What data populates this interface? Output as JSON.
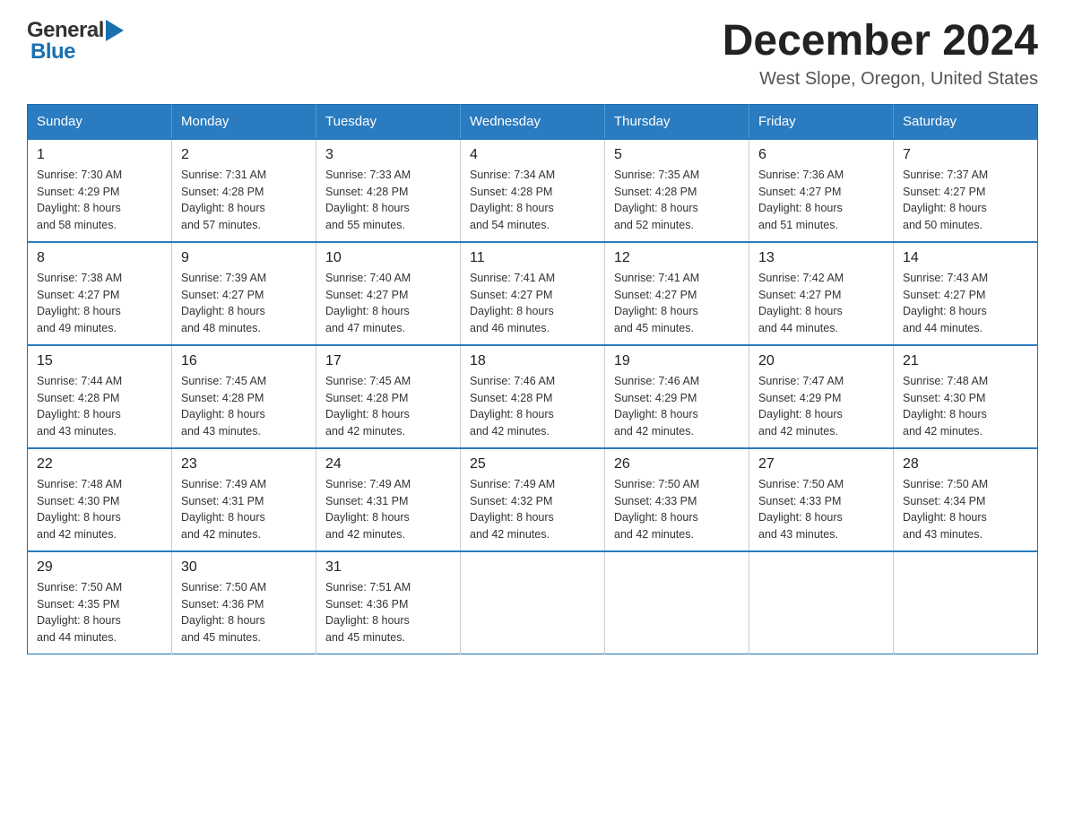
{
  "header": {
    "logo_general": "General",
    "logo_blue": "Blue",
    "month_title": "December 2024",
    "location": "West Slope, Oregon, United States"
  },
  "days_of_week": [
    "Sunday",
    "Monday",
    "Tuesday",
    "Wednesday",
    "Thursday",
    "Friday",
    "Saturday"
  ],
  "weeks": [
    [
      {
        "day": "1",
        "sunrise": "7:30 AM",
        "sunset": "4:29 PM",
        "daylight": "8 hours and 58 minutes."
      },
      {
        "day": "2",
        "sunrise": "7:31 AM",
        "sunset": "4:28 PM",
        "daylight": "8 hours and 57 minutes."
      },
      {
        "day": "3",
        "sunrise": "7:33 AM",
        "sunset": "4:28 PM",
        "daylight": "8 hours and 55 minutes."
      },
      {
        "day": "4",
        "sunrise": "7:34 AM",
        "sunset": "4:28 PM",
        "daylight": "8 hours and 54 minutes."
      },
      {
        "day": "5",
        "sunrise": "7:35 AM",
        "sunset": "4:28 PM",
        "daylight": "8 hours and 52 minutes."
      },
      {
        "day": "6",
        "sunrise": "7:36 AM",
        "sunset": "4:27 PM",
        "daylight": "8 hours and 51 minutes."
      },
      {
        "day": "7",
        "sunrise": "7:37 AM",
        "sunset": "4:27 PM",
        "daylight": "8 hours and 50 minutes."
      }
    ],
    [
      {
        "day": "8",
        "sunrise": "7:38 AM",
        "sunset": "4:27 PM",
        "daylight": "8 hours and 49 minutes."
      },
      {
        "day": "9",
        "sunrise": "7:39 AM",
        "sunset": "4:27 PM",
        "daylight": "8 hours and 48 minutes."
      },
      {
        "day": "10",
        "sunrise": "7:40 AM",
        "sunset": "4:27 PM",
        "daylight": "8 hours and 47 minutes."
      },
      {
        "day": "11",
        "sunrise": "7:41 AM",
        "sunset": "4:27 PM",
        "daylight": "8 hours and 46 minutes."
      },
      {
        "day": "12",
        "sunrise": "7:41 AM",
        "sunset": "4:27 PM",
        "daylight": "8 hours and 45 minutes."
      },
      {
        "day": "13",
        "sunrise": "7:42 AM",
        "sunset": "4:27 PM",
        "daylight": "8 hours and 44 minutes."
      },
      {
        "day": "14",
        "sunrise": "7:43 AM",
        "sunset": "4:27 PM",
        "daylight": "8 hours and 44 minutes."
      }
    ],
    [
      {
        "day": "15",
        "sunrise": "7:44 AM",
        "sunset": "4:28 PM",
        "daylight": "8 hours and 43 minutes."
      },
      {
        "day": "16",
        "sunrise": "7:45 AM",
        "sunset": "4:28 PM",
        "daylight": "8 hours and 43 minutes."
      },
      {
        "day": "17",
        "sunrise": "7:45 AM",
        "sunset": "4:28 PM",
        "daylight": "8 hours and 42 minutes."
      },
      {
        "day": "18",
        "sunrise": "7:46 AM",
        "sunset": "4:28 PM",
        "daylight": "8 hours and 42 minutes."
      },
      {
        "day": "19",
        "sunrise": "7:46 AM",
        "sunset": "4:29 PM",
        "daylight": "8 hours and 42 minutes."
      },
      {
        "day": "20",
        "sunrise": "7:47 AM",
        "sunset": "4:29 PM",
        "daylight": "8 hours and 42 minutes."
      },
      {
        "day": "21",
        "sunrise": "7:48 AM",
        "sunset": "4:30 PM",
        "daylight": "8 hours and 42 minutes."
      }
    ],
    [
      {
        "day": "22",
        "sunrise": "7:48 AM",
        "sunset": "4:30 PM",
        "daylight": "8 hours and 42 minutes."
      },
      {
        "day": "23",
        "sunrise": "7:49 AM",
        "sunset": "4:31 PM",
        "daylight": "8 hours and 42 minutes."
      },
      {
        "day": "24",
        "sunrise": "7:49 AM",
        "sunset": "4:31 PM",
        "daylight": "8 hours and 42 minutes."
      },
      {
        "day": "25",
        "sunrise": "7:49 AM",
        "sunset": "4:32 PM",
        "daylight": "8 hours and 42 minutes."
      },
      {
        "day": "26",
        "sunrise": "7:50 AM",
        "sunset": "4:33 PM",
        "daylight": "8 hours and 42 minutes."
      },
      {
        "day": "27",
        "sunrise": "7:50 AM",
        "sunset": "4:33 PM",
        "daylight": "8 hours and 43 minutes."
      },
      {
        "day": "28",
        "sunrise": "7:50 AM",
        "sunset": "4:34 PM",
        "daylight": "8 hours and 43 minutes."
      }
    ],
    [
      {
        "day": "29",
        "sunrise": "7:50 AM",
        "sunset": "4:35 PM",
        "daylight": "8 hours and 44 minutes."
      },
      {
        "day": "30",
        "sunrise": "7:50 AM",
        "sunset": "4:36 PM",
        "daylight": "8 hours and 45 minutes."
      },
      {
        "day": "31",
        "sunrise": "7:51 AM",
        "sunset": "4:36 PM",
        "daylight": "8 hours and 45 minutes."
      },
      null,
      null,
      null,
      null
    ]
  ],
  "labels": {
    "sunrise": "Sunrise:",
    "sunset": "Sunset:",
    "daylight": "Daylight:"
  }
}
